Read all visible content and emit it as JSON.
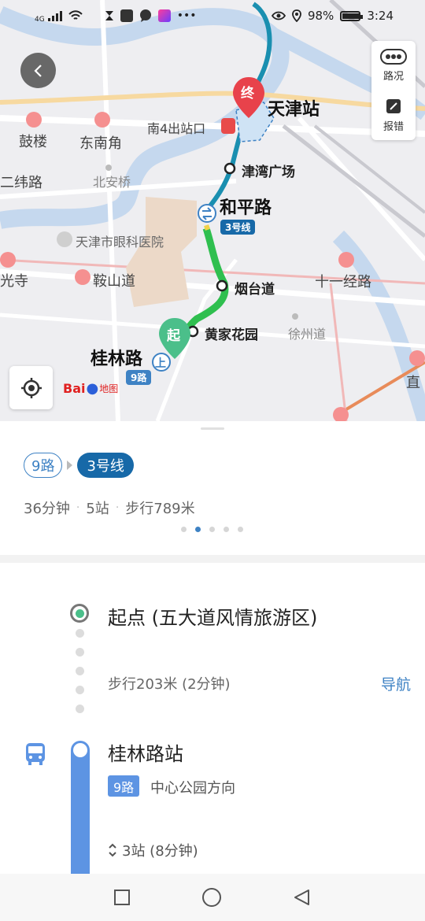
{
  "status_bar": {
    "net": "4G",
    "battery": "98%",
    "time": "3:24"
  },
  "map": {
    "places": {
      "gulou": "鼓楼",
      "dongnanjiao": "东南角",
      "erweilu": "二纬路",
      "beianqiao": "北安桥",
      "hospital": "天津市眼科医院",
      "guangsi": "光寺",
      "anshandao": "鞍山道",
      "shiyijinglu": "十一经路",
      "xuzhoudao": "徐州道",
      "zhi": "直",
      "south_exit": "南4出站口"
    },
    "stations": {
      "end": "天津站",
      "jinwan": "津湾广场",
      "heping": "和平路",
      "yantai": "烟台道",
      "huangjia": "黄家花园",
      "guilin": "桂林路"
    },
    "markers": {
      "end": "终",
      "start": "起",
      "up": "上"
    },
    "badges": {
      "line3": "3号线",
      "line9": "9路"
    },
    "baidu_logo": {
      "text": "Bai",
      "du": "du",
      "ditu": "地图"
    }
  },
  "side_panel": {
    "traffic_label": "路况",
    "report_label": "报错"
  },
  "route_card": {
    "chip_bus": "9路",
    "chip_metro": "3号线",
    "duration": "36分钟",
    "stops": "5站",
    "walk": "步行789米",
    "separator": "·",
    "page_count": 5,
    "active_page": 1
  },
  "itinerary": {
    "start_title": "起点 (五大道风情旅游区)",
    "walk_text": "步行203米 (2分钟)",
    "nav_label": "导航",
    "station_title": "桂林路站",
    "route_tag": "9路",
    "direction": "中心公园方向",
    "ride_stops": "3站 (8分钟)"
  },
  "colors": {
    "accent": "#3e82c4",
    "metro": "#1769a8",
    "bus_green": "#2fbf4f",
    "end_red": "#e8424b",
    "start_green": "#4bbf8a"
  }
}
